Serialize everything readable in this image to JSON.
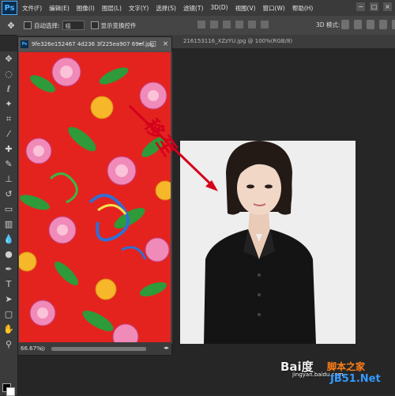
{
  "app": {
    "logo": "Ps"
  },
  "menu": [
    "文件(F)",
    "编辑(E)",
    "图像(I)",
    "图层(L)",
    "文字(Y)",
    "选择(S)",
    "滤镜(T)",
    "3D(D)",
    "视图(V)",
    "窗口(W)",
    "帮助(H)"
  ],
  "window_controls": [
    "−",
    "□",
    "×"
  ],
  "options": {
    "auto_select_label": "自动选择:",
    "auto_select_value": "组",
    "show_transform_label": "显示变换控件",
    "mode3d_label": "3D 模式:"
  },
  "tabs": {
    "background_title": "216153116_XZzYU.jpg @ 100%(RGB/8)"
  },
  "float_window": {
    "title": "9fe326e152467 4d236 3f225ea907 69ef.jpg",
    "zoom": "66.67%",
    "controls": [
      "−",
      "□",
      "×"
    ]
  },
  "annotation": {
    "text": "移至",
    "color": "#d4001c"
  },
  "watermarks": {
    "baidu": "Bai度",
    "jingyan": "jingyan.baidu.com",
    "site_cn": "脚本之家",
    "site_en": "JB51.Net"
  },
  "tools": [
    "move-icon",
    "marquee-icon",
    "lasso-icon",
    "magic-wand-icon",
    "crop-icon",
    "eyedropper-icon",
    "healing-icon",
    "brush-icon",
    "stamp-icon",
    "history-brush-icon",
    "eraser-icon",
    "gradient-icon",
    "blur-icon",
    "dodge-icon",
    "pen-icon",
    "type-icon",
    "path-select-icon",
    "shape-icon",
    "hand-icon",
    "zoom-icon"
  ],
  "colors": {
    "fabric_red": "#e4231f",
    "ps_blue": "#4fb2ff",
    "arrow": "#d4001c"
  }
}
